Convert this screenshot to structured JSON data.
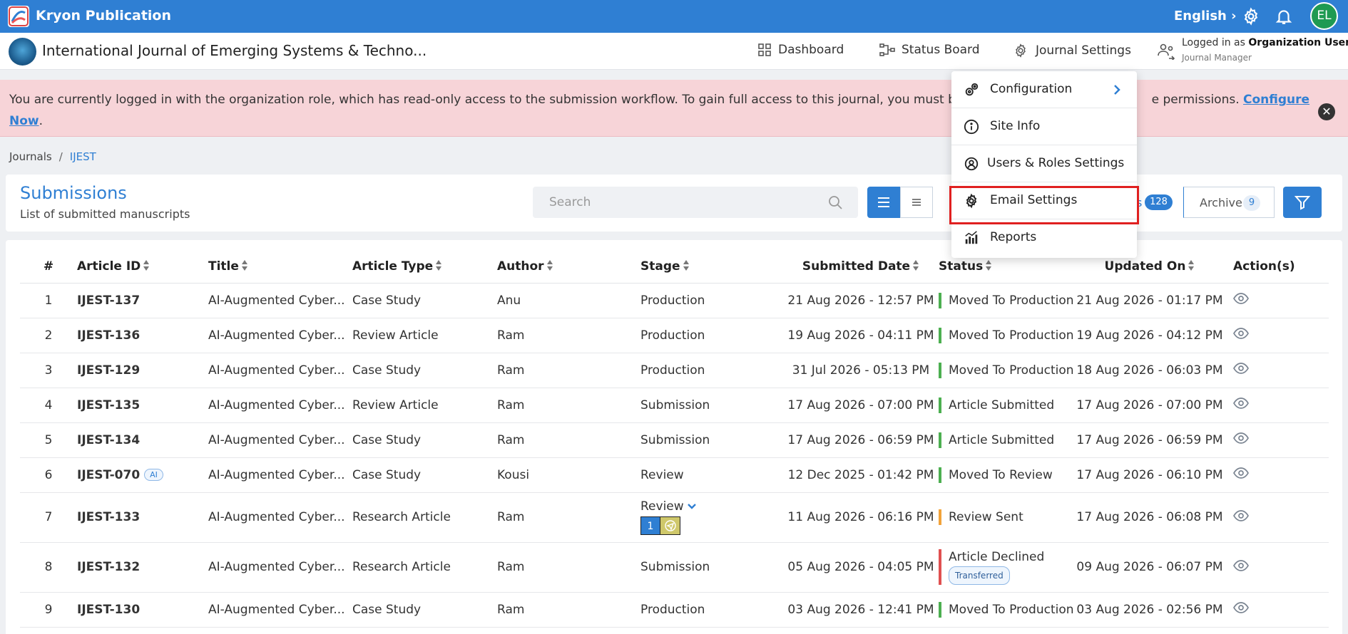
{
  "app": {
    "brand": "Kryon Publication",
    "language": "English",
    "avatar_initials": "EL"
  },
  "journal_header": {
    "title": "International Journal of Emerging Systems & Techno...",
    "nav": {
      "dashboard": "Dashboard",
      "status_board": "Status Board",
      "journal_settings": "Journal Settings"
    },
    "logged_in_prefix": "Logged in as",
    "logged_in_user": "Organization User",
    "role": "Journal Manager"
  },
  "alert": {
    "text": "You are currently logged in with the organization role, which has read-only access to the submission workflow. To gain full access to this journal, you must be assi",
    "text_tail": "e permissions.",
    "link": "Configure Now",
    "link_end": "."
  },
  "breadcrumb": {
    "root": "Journals",
    "current": "IJEST"
  },
  "submissions": {
    "title": "Submissions",
    "subtitle": "List of submitted manuscripts",
    "search_placeholder": "Search",
    "tab_suffix": "s",
    "active_count": "128",
    "archive_label": "Archive",
    "archive_count": "9"
  },
  "dropdown": {
    "items": [
      {
        "label": "Configuration",
        "icon": "gears-icon"
      },
      {
        "label": "Site Info",
        "icon": "info-icon"
      },
      {
        "label": "Users & Roles Settings",
        "icon": "users-gear-icon"
      },
      {
        "label": "Email Settings",
        "icon": "gear-icon"
      },
      {
        "label": "Reports",
        "icon": "bar-chart-icon"
      }
    ]
  },
  "table": {
    "headers": {
      "num": "#",
      "article_id": "Article ID",
      "title": "Title",
      "article_type": "Article Type",
      "author": "Author",
      "stage": "Stage",
      "submitted_date": "Submitted Date",
      "status": "Status",
      "updated_on": "Updated On",
      "actions": "Action(s)"
    },
    "rows": [
      {
        "num": "1",
        "id": "IJEST-137",
        "title": "AI-Augmented Cyber...",
        "type": "Case Study",
        "author": "Anu",
        "stage": "Production",
        "submitted": "21 Aug 2026 - 12:57 PM",
        "status": "Moved To Production",
        "updated": "21 Aug 2026 - 01:17 PM"
      },
      {
        "num": "2",
        "id": "IJEST-136",
        "title": "AI-Augmented Cyber...",
        "type": "Review Article",
        "author": "Ram",
        "stage": "Production",
        "submitted": "19 Aug 2026 - 04:11 PM",
        "status": "Moved To Production",
        "updated": "19 Aug 2026 - 04:12 PM"
      },
      {
        "num": "3",
        "id": "IJEST-129",
        "title": "AI-Augmented Cyber...",
        "type": "Case Study",
        "author": "Ram",
        "stage": "Production",
        "submitted": "31 Jul 2026 - 05:13 PM",
        "status": "Moved To Production",
        "updated": "18 Aug 2026 - 06:03 PM"
      },
      {
        "num": "4",
        "id": "IJEST-135",
        "title": "AI-Augmented Cyber...",
        "type": "Review Article",
        "author": "Ram",
        "stage": "Submission",
        "submitted": "17 Aug 2026 - 07:00 PM",
        "status": "Article Submitted",
        "updated": "17 Aug 2026 - 07:00 PM"
      },
      {
        "num": "5",
        "id": "IJEST-134",
        "title": "AI-Augmented Cyber...",
        "type": "Case Study",
        "author": "Ram",
        "stage": "Submission",
        "submitted": "17 Aug 2026 - 06:59 PM",
        "status": "Article Submitted",
        "updated": "17 Aug 2026 - 06:59 PM"
      },
      {
        "num": "6",
        "id": "IJEST-070",
        "badge": "AI",
        "title": "AI-Augmented Cyber...",
        "type": "Case Study",
        "author": "Kousi",
        "stage": "Review",
        "submitted": "12 Dec 2025 - 01:42 PM",
        "status": "Moved To Review",
        "updated": "17 Aug 2026 - 06:10 PM"
      },
      {
        "num": "7",
        "id": "IJEST-133",
        "title": "AI-Augmented Cyber...",
        "type": "Research Article",
        "author": "Ram",
        "stage": "Review",
        "round": "1",
        "submitted": "11 Aug 2026 - 06:16 PM",
        "status": "Review Sent",
        "updated": "17 Aug 2026 - 06:08 PM"
      },
      {
        "num": "8",
        "id": "IJEST-132",
        "title": "AI-Augmented Cyber...",
        "type": "Research Article",
        "author": "Ram",
        "stage": "Submission",
        "submitted": "05 Aug 2026 - 04:05 PM",
        "status": "Article Declined",
        "status_badge": "Transferred",
        "updated": "09 Aug 2026 - 06:07 PM"
      },
      {
        "num": "9",
        "id": "IJEST-130",
        "title": "AI-Augmented Cyber...",
        "type": "Case Study",
        "author": "Ram",
        "stage": "Production",
        "submitted": "03 Aug 2026 - 12:41 PM",
        "status": "Moved To Production",
        "updated": "03 Aug 2026 - 02:56 PM"
      }
    ]
  },
  "colors": {
    "primary": "#2f7fd3",
    "alert_bg": "#f7d4d8",
    "status_green": "#4caf50",
    "status_orange": "#f2a33a",
    "status_red": "#e05050",
    "highlight": "#e02020"
  }
}
